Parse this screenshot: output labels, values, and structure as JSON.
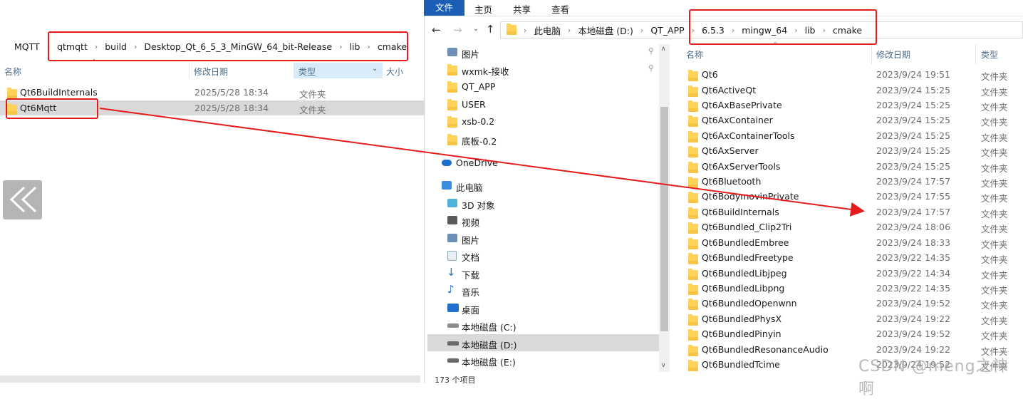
{
  "left": {
    "breadcrumb": [
      "MQTT",
      "qtmqtt",
      "build",
      "Desktop_Qt_6_5_3_MinGW_64_bit-Release",
      "lib",
      "cmake"
    ],
    "headers": {
      "name": "名称",
      "date": "修改日期",
      "type": "类型",
      "size": "大小"
    },
    "rows": [
      {
        "name": "Qt6BuildInternals",
        "date": "2025/5/28 18:34",
        "type": "文件夹"
      },
      {
        "name": "Qt6Mqtt",
        "date": "2025/5/28 18:34",
        "type": "文件夹"
      }
    ]
  },
  "right": {
    "tabs": [
      "文件",
      "主页",
      "共享",
      "查看"
    ],
    "breadcrumb": [
      "此电脑",
      "本地磁盘 (D:)",
      "QT_APP",
      "6.5.3",
      "mingw_64",
      "lib",
      "cmake"
    ],
    "nav": [
      {
        "label": "图片",
        "icon": "pictures-icon",
        "pinned": true
      },
      {
        "label": "wxmk-接收",
        "icon": "folder-icon"
      },
      {
        "label": "QT_APP",
        "icon": "folder-icon"
      },
      {
        "label": "USER",
        "icon": "folder-icon"
      },
      {
        "label": "xsb-0.2",
        "icon": "folder-icon"
      },
      {
        "label": "底板-0.2",
        "icon": "folder-icon"
      },
      {
        "label": "OneDrive",
        "icon": "cloud-icon"
      },
      {
        "label": "此电脑",
        "icon": "pc-icon"
      },
      {
        "label": "3D 对象",
        "icon": "cube-icon"
      },
      {
        "label": "视频",
        "icon": "video-icon"
      },
      {
        "label": "图片",
        "icon": "pictures-icon"
      },
      {
        "label": "文档",
        "icon": "document-icon"
      },
      {
        "label": "下载",
        "icon": "download-icon"
      },
      {
        "label": "音乐",
        "icon": "music-icon"
      },
      {
        "label": "桌面",
        "icon": "desktop-icon"
      },
      {
        "label": "本地磁盘 (C:)",
        "icon": "drive-icon"
      },
      {
        "label": "本地磁盘 (D:)",
        "icon": "drive-icon",
        "selected": true
      },
      {
        "label": "本地磁盘 (E:)",
        "icon": "drive-icon"
      }
    ],
    "headers": {
      "name": "名称",
      "date": "修改日期",
      "type": "类型"
    },
    "rows": [
      {
        "name": "Qt6",
        "date": "2023/9/24 19:51",
        "type": "文件夹"
      },
      {
        "name": "Qt6ActiveQt",
        "date": "2023/9/24 15:25",
        "type": "文件夹"
      },
      {
        "name": "Qt6AxBasePrivate",
        "date": "2023/9/24 15:25",
        "type": "文件夹"
      },
      {
        "name": "Qt6AxContainer",
        "date": "2023/9/24 15:25",
        "type": "文件夹"
      },
      {
        "name": "Qt6AxContainerTools",
        "date": "2023/9/24 15:25",
        "type": "文件夹"
      },
      {
        "name": "Qt6AxServer",
        "date": "2023/9/24 15:25",
        "type": "文件夹"
      },
      {
        "name": "Qt6AxServerTools",
        "date": "2023/9/24 15:25",
        "type": "文件夹"
      },
      {
        "name": "Qt6Bluetooth",
        "date": "2023/9/24 17:57",
        "type": "文件夹"
      },
      {
        "name": "Qt6BodymovinPrivate",
        "date": "2023/9/24 17:55",
        "type": "文件夹"
      },
      {
        "name": "Qt6BuildInternals",
        "date": "2023/9/24 17:57",
        "type": "文件夹"
      },
      {
        "name": "Qt6Bundled_Clip2Tri",
        "date": "2023/9/24 18:06",
        "type": "文件夹"
      },
      {
        "name": "Qt6BundledEmbree",
        "date": "2023/9/24 18:33",
        "type": "文件夹"
      },
      {
        "name": "Qt6BundledFreetype",
        "date": "2023/9/22 14:35",
        "type": "文件夹"
      },
      {
        "name": "Qt6BundledLibjpeg",
        "date": "2023/9/22 14:34",
        "type": "文件夹"
      },
      {
        "name": "Qt6BundledLibpng",
        "date": "2023/9/22 14:35",
        "type": "文件夹"
      },
      {
        "name": "Qt6BundledOpenwnn",
        "date": "2023/9/24 19:52",
        "type": "文件夹"
      },
      {
        "name": "Qt6BundledPhysX",
        "date": "2023/9/24 19:22",
        "type": "文件夹"
      },
      {
        "name": "Qt6BundledPinyin",
        "date": "2023/9/24 19:52",
        "type": "文件夹"
      },
      {
        "name": "Qt6BundledResonanceAudio",
        "date": "2023/9/24 19:22",
        "type": "文件夹"
      },
      {
        "name": "Qt6BundledTcime",
        "date": "2023/9/24 19:52",
        "type": "文件夹"
      }
    ],
    "status": "173 个项目"
  },
  "watermark": "CSDN @meng之神啊",
  "colors": {
    "highlight": "#e51c1c",
    "accent": "#1a5fb4",
    "selected": "#cce8ff"
  }
}
